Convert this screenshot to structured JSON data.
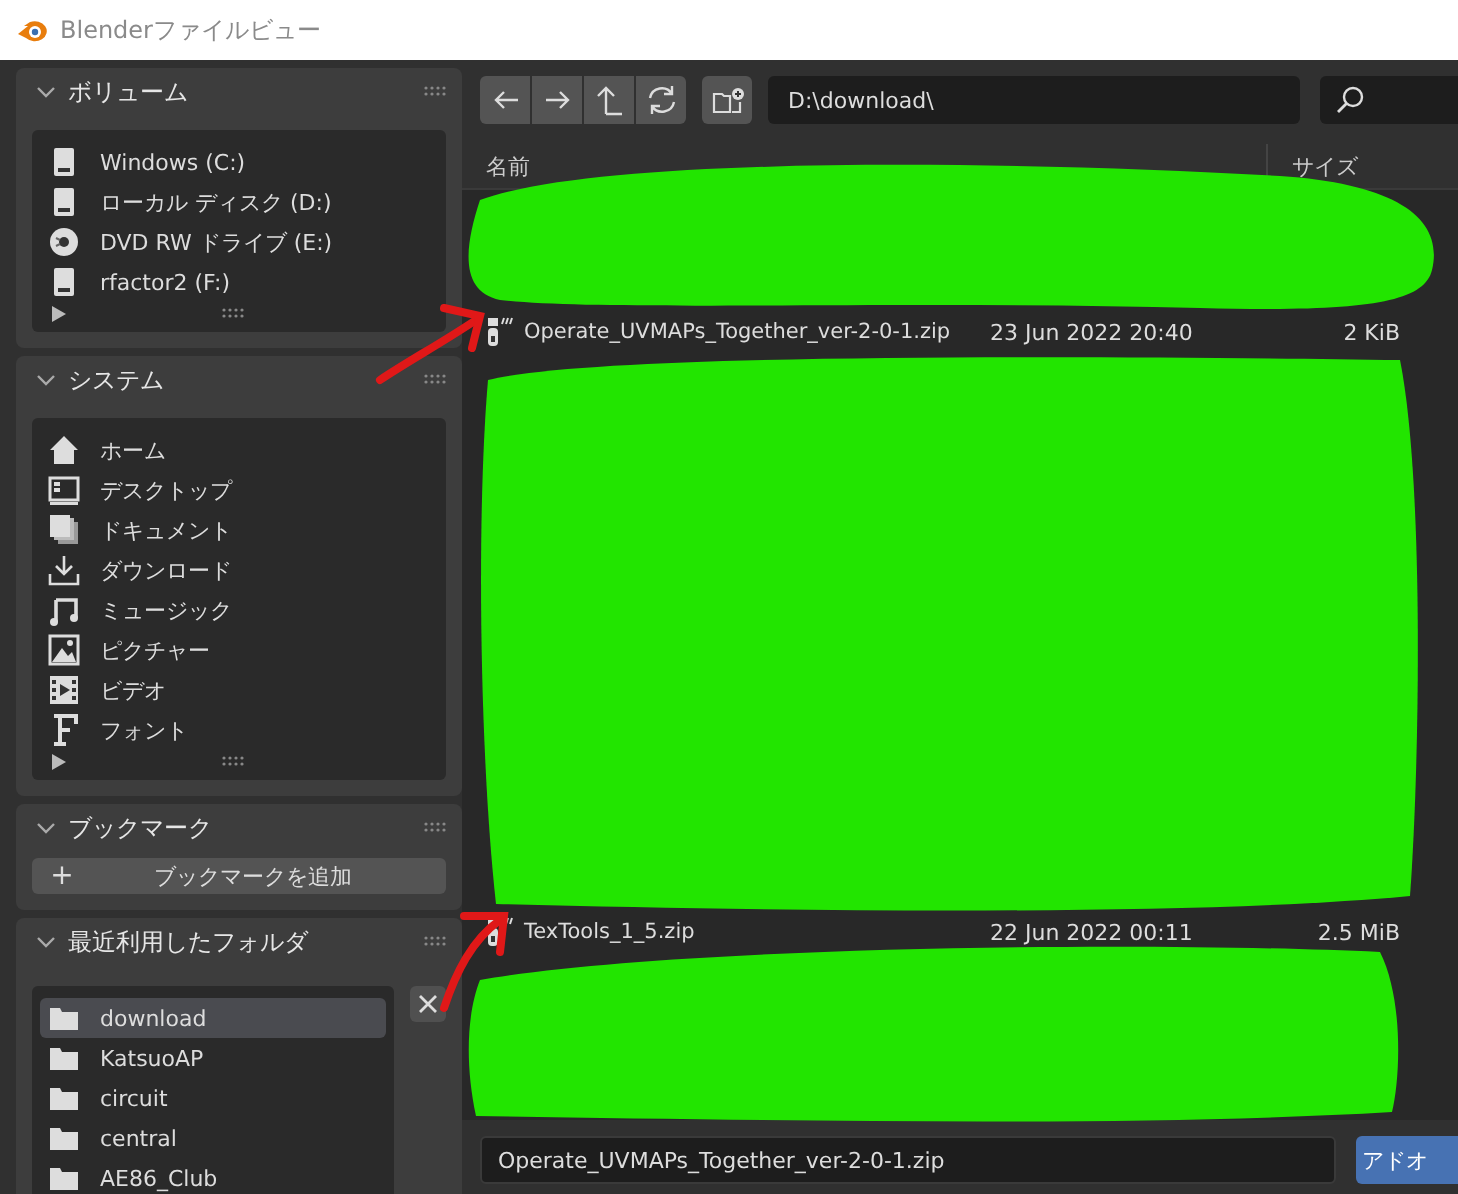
{
  "window": {
    "title": "Blenderファイルビュー"
  },
  "sidebar": [
    {
      "kind": "list",
      "title": "ボリューム",
      "expanded": true,
      "items": [
        {
          "kind": "disk",
          "label": "Windows (C:)"
        },
        {
          "kind": "disk",
          "label": "ローカル ディスク (D:)"
        },
        {
          "kind": "dvd",
          "label": "DVD RW ドライブ (E:)"
        },
        {
          "kind": "disk",
          "label": "rfactor2 (F:)"
        }
      ]
    },
    {
      "kind": "list",
      "title": "システム",
      "expanded": true,
      "items": [
        {
          "kind": "home",
          "label": "ホーム"
        },
        {
          "kind": "desktop",
          "label": "デスクトップ"
        },
        {
          "kind": "documents",
          "label": "ドキュメント"
        },
        {
          "kind": "download",
          "label": "ダウンロード"
        },
        {
          "kind": "music",
          "label": "ミュージック"
        },
        {
          "kind": "image",
          "label": "ピクチャー"
        },
        {
          "kind": "video",
          "label": "ビデオ"
        },
        {
          "kind": "font",
          "label": "フォント"
        }
      ]
    },
    {
      "kind": "button",
      "title": "ブックマーク",
      "expanded": true,
      "button_icon": "+",
      "button": "ブックマークを追加"
    },
    {
      "kind": "recent",
      "title": "最近利用したフォルダ",
      "expanded": true,
      "items": [
        {
          "kind": "folder",
          "label": "download",
          "selected": true
        },
        {
          "kind": "folder",
          "label": "KatsuoAP",
          "selected": false
        },
        {
          "kind": "folder",
          "label": "circuit",
          "selected": false
        },
        {
          "kind": "folder",
          "label": "central",
          "selected": false
        },
        {
          "kind": "folder",
          "label": "AE86_Club",
          "selected": false
        }
      ]
    }
  ],
  "toolbar": {
    "path": "D:\\download\\"
  },
  "file_list": {
    "column_1": "名前",
    "column_3": "サイズ",
    "files": [
      {
        "name": "Operate_UVMAPs_Together_ver-2-0-1.zip",
        "date": "23 Jun 2022 20:40",
        "size": "2 KiB"
      },
      {
        "name": "TexTools_1_5.zip",
        "date": "22 Jun 2022 00:11",
        "size": "2.5 MiB"
      }
    ]
  },
  "filename_field": {
    "value": "Operate_UVMAPs_Together_ver-2-0-1.zip"
  },
  "accept_button": "アドオ",
  "overlay_marks": [
    {
      "kind": "scribble",
      "color": "#22e500"
    },
    {
      "kind": "scribble",
      "color": "#22e500"
    },
    {
      "kind": "scribble",
      "color": "#22e500"
    },
    {
      "kind": "arrow",
      "color": "#e01818"
    },
    {
      "kind": "arrow",
      "color": "#e01818"
    }
  ]
}
